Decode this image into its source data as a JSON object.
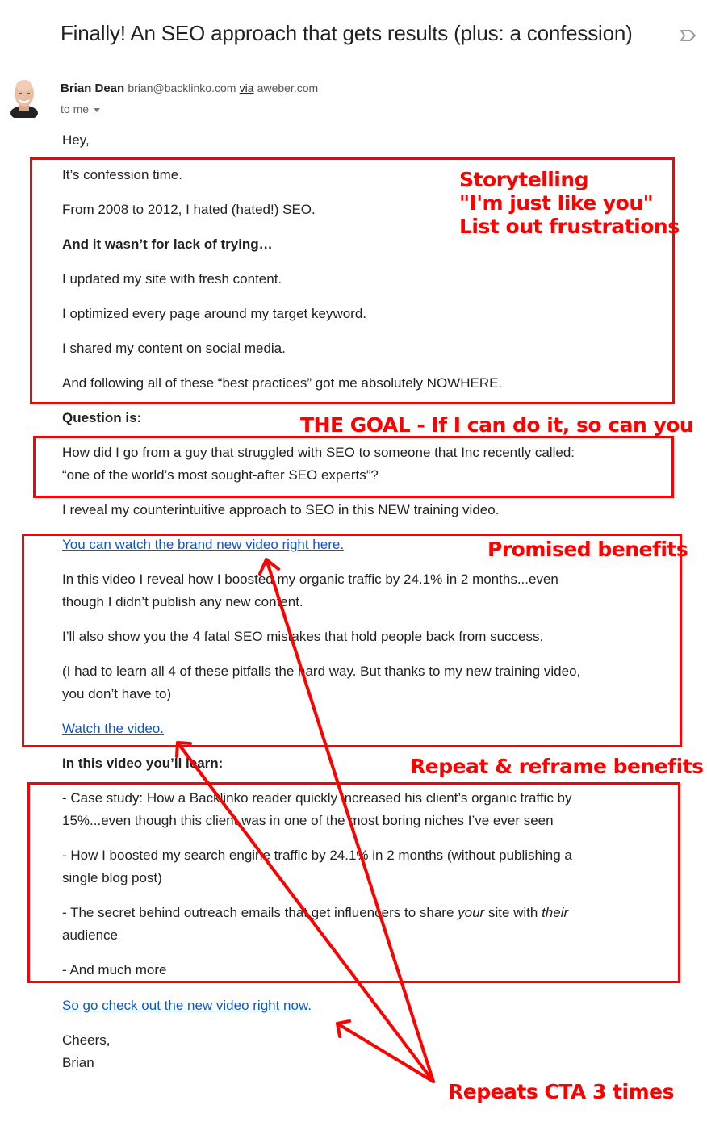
{
  "email": {
    "subject": "Finally! An SEO approach that gets results (plus: a confession)",
    "label_icon": "label-tag-icon",
    "sender": {
      "name": "Brian Dean",
      "email": "brian@backlinko.com",
      "via_label": "via",
      "via_domain": "aweber.com",
      "avatar": "avatar-photo",
      "recipient_label": "to me"
    },
    "body": {
      "greeting": "Hey,",
      "p1": "It’s confession time.",
      "p2": "From 2008 to 2012, I hated (hated!) SEO.",
      "p3_bold": "And it wasn’t for lack of trying…",
      "p4": "I updated my site with fresh content.",
      "p5": "I optimized every page around my target keyword.",
      "p6": "I shared my content on social media.",
      "p7": "And following all of these “best practices” got me absolutely NOWHERE.",
      "question_bold": "Question is:",
      "question_line1": "How did I go from a guy that struggled with SEO to someone that Inc recently called:",
      "question_line2": "“one of the world’s most sought-after SEO experts”?",
      "reveal": "I reveal my counterintuitive approach to SEO in this NEW training video.",
      "cta1": "You can watch the brand new video right here.",
      "benefit1_line1": "In this video I reveal how I boosted my organic traffic by 24.1% in 2 months...even",
      "benefit1_line2": "though I didn’t publish any new content.",
      "benefit2": "I’ll also show you the 4 fatal SEO mistakes that hold people back from success.",
      "benefit3_line1": "(I had to learn all 4 of these pitfalls the hard way. But thanks to my new training video,",
      "benefit3_line2": "you don’t have to)",
      "cta2": "Watch the video.",
      "learn_bold": "In this video you’ll learn:",
      "bullet1_line1": "- Case study: How a Backlinko reader quickly increased his client’s organic traffic by",
      "bullet1_line2": "15%...even though this client was in one of the most boring niches I’ve ever seen",
      "bullet2_line1": "- How I boosted my search engine traffic by 24.1% in 2 months (without publishing a",
      "bullet2_line2": "single blog post)",
      "bullet3_pre": "- The secret behind outreach emails that get influencers to share ",
      "bullet3_em1": "your",
      "bullet3_mid": " site with ",
      "bullet3_em2": "their",
      "bullet3_line2": "audience",
      "bullet4": "- And much more",
      "cta3": "So go check out the new video right now.",
      "signoff": "Cheers,",
      "signature": "Brian"
    }
  },
  "annotations": {
    "color": "#ff0000",
    "storytelling": [
      "Storytelling",
      "\"I'm just like you\"",
      "List out frustrations"
    ],
    "goal": "THE GOAL - If I can do it, so can you",
    "promised": "Promised benefits",
    "repeat": "Repeat & reframe benefits",
    "cta": "Repeats CTA 3 times"
  },
  "colors": {
    "link": "#1155cc",
    "annotation": "#ff0000",
    "text": "#222222"
  }
}
